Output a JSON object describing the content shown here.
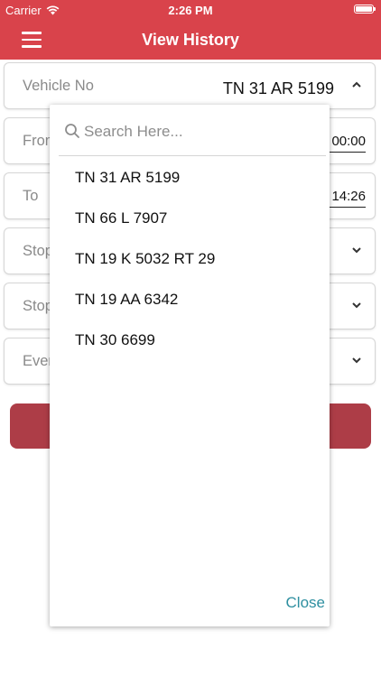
{
  "status_bar": {
    "carrier": "Carrier",
    "time": "2:26 PM"
  },
  "header": {
    "title": "View History"
  },
  "form": {
    "vehicle": {
      "label": "Vehicle No",
      "value": "TN 31 AR 5199"
    },
    "from": {
      "label": "From",
      "time": "00:00"
    },
    "to": {
      "label": "To",
      "time": "14:26"
    },
    "stop1": {
      "label": "Stop"
    },
    "stop2": {
      "label": "Stop"
    },
    "event": {
      "label": "Even"
    }
  },
  "dropdown": {
    "search_placeholder": "Search Here...",
    "options": [
      "TN 31 AR 5199",
      "TN 66 L 7907",
      "TN 19 K 5032 RT 29",
      "TN 19 AA 6342",
      "TN 30 6699"
    ],
    "close_label": "Close"
  },
  "colors": {
    "brand": "#d9434b",
    "button": "#ad3d47",
    "link": "#2e8fa0"
  },
  "icons": [
    "wifi-icon",
    "battery-icon",
    "menu-icon",
    "chevron-up-icon",
    "chevron-down-icon",
    "search-icon"
  ]
}
